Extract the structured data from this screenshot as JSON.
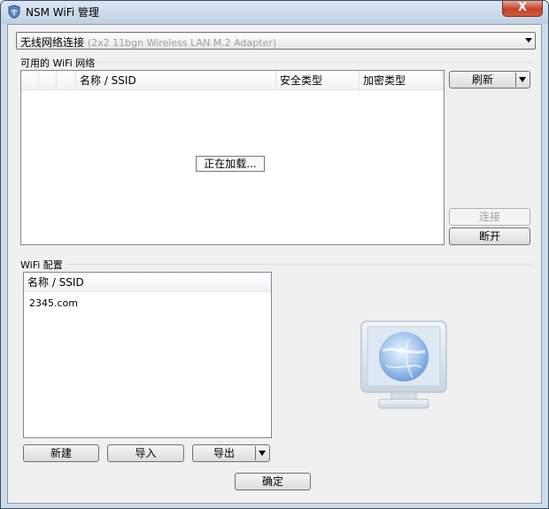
{
  "window": {
    "title": "NSM WiFi 管理",
    "close_glyph": "X"
  },
  "adapter_combo": {
    "selected_label": "无线网络连接",
    "selected_detail": "(2x2 11bgn Wireless LAN M.2 Adapter)"
  },
  "available_networks": {
    "group_title": "可用的 WiFi 网络",
    "columns": [
      "名称 / SSID",
      "安全类型",
      "加密类型"
    ],
    "loading_text": "正在加载..."
  },
  "side_buttons": {
    "refresh": "刷新",
    "connect": "连接",
    "disconnect": "断开"
  },
  "wifi_config": {
    "group_title": "WiFi 配置",
    "column": "名称 / SSID",
    "profiles": [
      "2345.com"
    ]
  },
  "config_buttons": {
    "new": "新建",
    "import": "导入",
    "export": "导出"
  },
  "footer": {
    "ok": "确定"
  },
  "icons": {
    "app": "wifi-shield-icon",
    "monitor": "globe-monitor-icon"
  }
}
